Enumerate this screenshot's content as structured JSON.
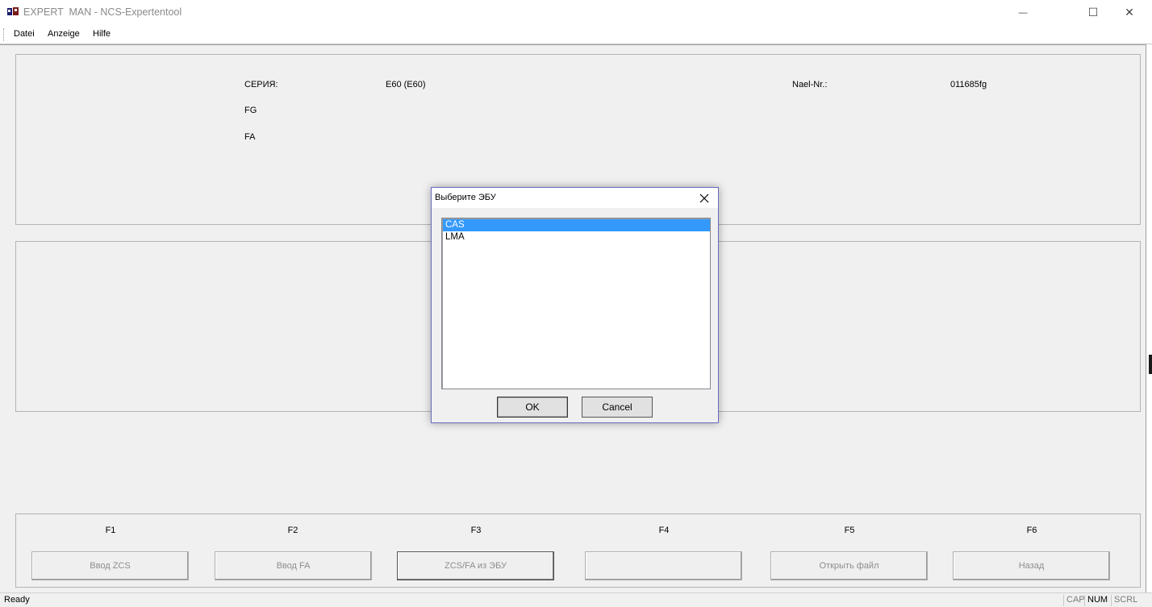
{
  "window": {
    "title": "EXPERT  MAN - NCS-Expertentool",
    "minimize_glyph": "—",
    "maximize_glyph": "☐",
    "close_glyph": "✕"
  },
  "menu": {
    "items": [
      {
        "label": "Datei"
      },
      {
        "label": "Anzeige"
      },
      {
        "label": "Hilfe"
      }
    ]
  },
  "info_panel": {
    "series_label": "СЕРИЯ:",
    "series_value": "E60 (E60)",
    "fg_label": "FG",
    "fa_label": "FA",
    "nael_label": "Nael-Nr.:",
    "nael_value": "011685fg"
  },
  "function_keys": [
    {
      "key": "F1",
      "button": "Ввод ZCS",
      "enabled": false
    },
    {
      "key": "F2",
      "button": "Ввод FA",
      "enabled": false
    },
    {
      "key": "F3",
      "button": "ZCS/FA из ЭБУ",
      "enabled": false
    },
    {
      "key": "F4",
      "button": "",
      "enabled": false
    },
    {
      "key": "F5",
      "button": "Открыть файл",
      "enabled": false
    },
    {
      "key": "F6",
      "button": "Назад",
      "enabled": false
    }
  ],
  "status": {
    "text": "Ready",
    "indicators": [
      {
        "label": "CAP",
        "active": false
      },
      {
        "label": "NUM",
        "active": true
      },
      {
        "label": "SCRL",
        "active": false
      }
    ]
  },
  "dialog": {
    "title": "Выберите ЭБУ",
    "close_glyph": "✕",
    "list_items": [
      {
        "label": "CAS",
        "selected": true
      },
      {
        "label": "LMA",
        "selected": false
      }
    ],
    "ok_label": "OK",
    "cancel_label": "Cancel"
  },
  "colors": {
    "selection": "#3399ff",
    "dialog_border": "#6b6bbf",
    "background": "#f0f0f0"
  }
}
